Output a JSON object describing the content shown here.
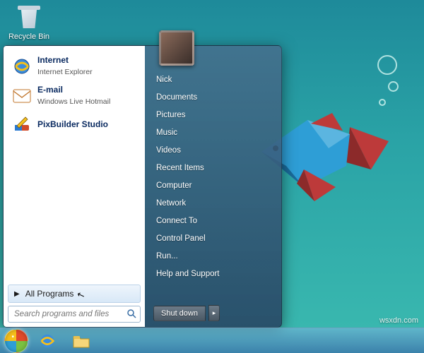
{
  "desktop": {
    "icons": [
      {
        "label": "Recycle Bin"
      }
    ]
  },
  "start_menu": {
    "pinned": [
      {
        "title": "Internet",
        "subtitle": "Internet Explorer",
        "icon": "ie-icon"
      },
      {
        "title": "E-mail",
        "subtitle": "Windows Live Hotmail",
        "icon": "mail-icon"
      },
      {
        "title": "PixBuilder Studio",
        "subtitle": "",
        "icon": "pixbuilder-icon"
      }
    ],
    "all_programs_label": "All Programs",
    "search_placeholder": "Search programs and files",
    "right_items": [
      "Nick",
      "Documents",
      "Pictures",
      "Music",
      "Videos",
      "Recent Items",
      "Computer",
      "Network",
      "Connect To",
      "Control Panel",
      "Run...",
      "Help and Support"
    ],
    "shutdown_label": "Shut down"
  },
  "taskbar": {
    "items": [
      {
        "name": "start-orb"
      },
      {
        "name": "ie-icon"
      },
      {
        "name": "explorer-icon"
      }
    ]
  },
  "watermark": "wsxdn.com",
  "colors": {
    "desktop_bg_top": "#1e8a9a",
    "desktop_bg_bottom": "#3bbab0",
    "fish_body": "#2e9ed6",
    "fish_fin": "#bd3a3a"
  }
}
